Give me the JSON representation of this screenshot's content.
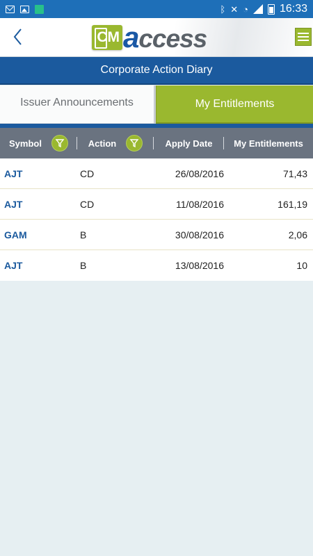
{
  "status_bar": {
    "time": "16:33",
    "left_icons": [
      "mail-icon",
      "image-icon",
      "app-icon"
    ],
    "right_icons": [
      "bluetooth-icon",
      "mute-icon",
      "wifi-icon",
      "signal-icon",
      "battery-icon"
    ]
  },
  "header": {
    "back_icon": "chevron-left-icon",
    "logo_text": "access",
    "logo_mark_text": "CM",
    "menu_icon": "hamburger-icon"
  },
  "title_bar": {
    "title": "Corporate Action Diary"
  },
  "tabs": [
    {
      "label": "Issuer Announcements",
      "active": false
    },
    {
      "label": "My Entitlements",
      "active": true
    }
  ],
  "table": {
    "columns": [
      {
        "label": "Symbol",
        "filter": true
      },
      {
        "label": "Action",
        "filter": true
      },
      {
        "label": "Apply Date",
        "filter": false
      },
      {
        "label": "My Entitlements",
        "filter": false
      }
    ],
    "rows": [
      {
        "symbol": "AJT",
        "action": "CD",
        "apply_date": "26/08/2016",
        "entitlement": "71,43"
      },
      {
        "symbol": "AJT",
        "action": "CD",
        "apply_date": "11/08/2016",
        "entitlement": "161,19"
      },
      {
        "symbol": "GAM",
        "action": "B",
        "apply_date": "30/08/2016",
        "entitlement": "2,06"
      },
      {
        "symbol": "AJT",
        "action": "B",
        "apply_date": "13/08/2016",
        "entitlement": "10"
      }
    ]
  },
  "colors": {
    "status_bar": "#1e6fb8",
    "primary_blue": "#1b5a9e",
    "accent_green": "#9ab82f",
    "table_header": "#6a7380",
    "background": "#e6eff2"
  }
}
